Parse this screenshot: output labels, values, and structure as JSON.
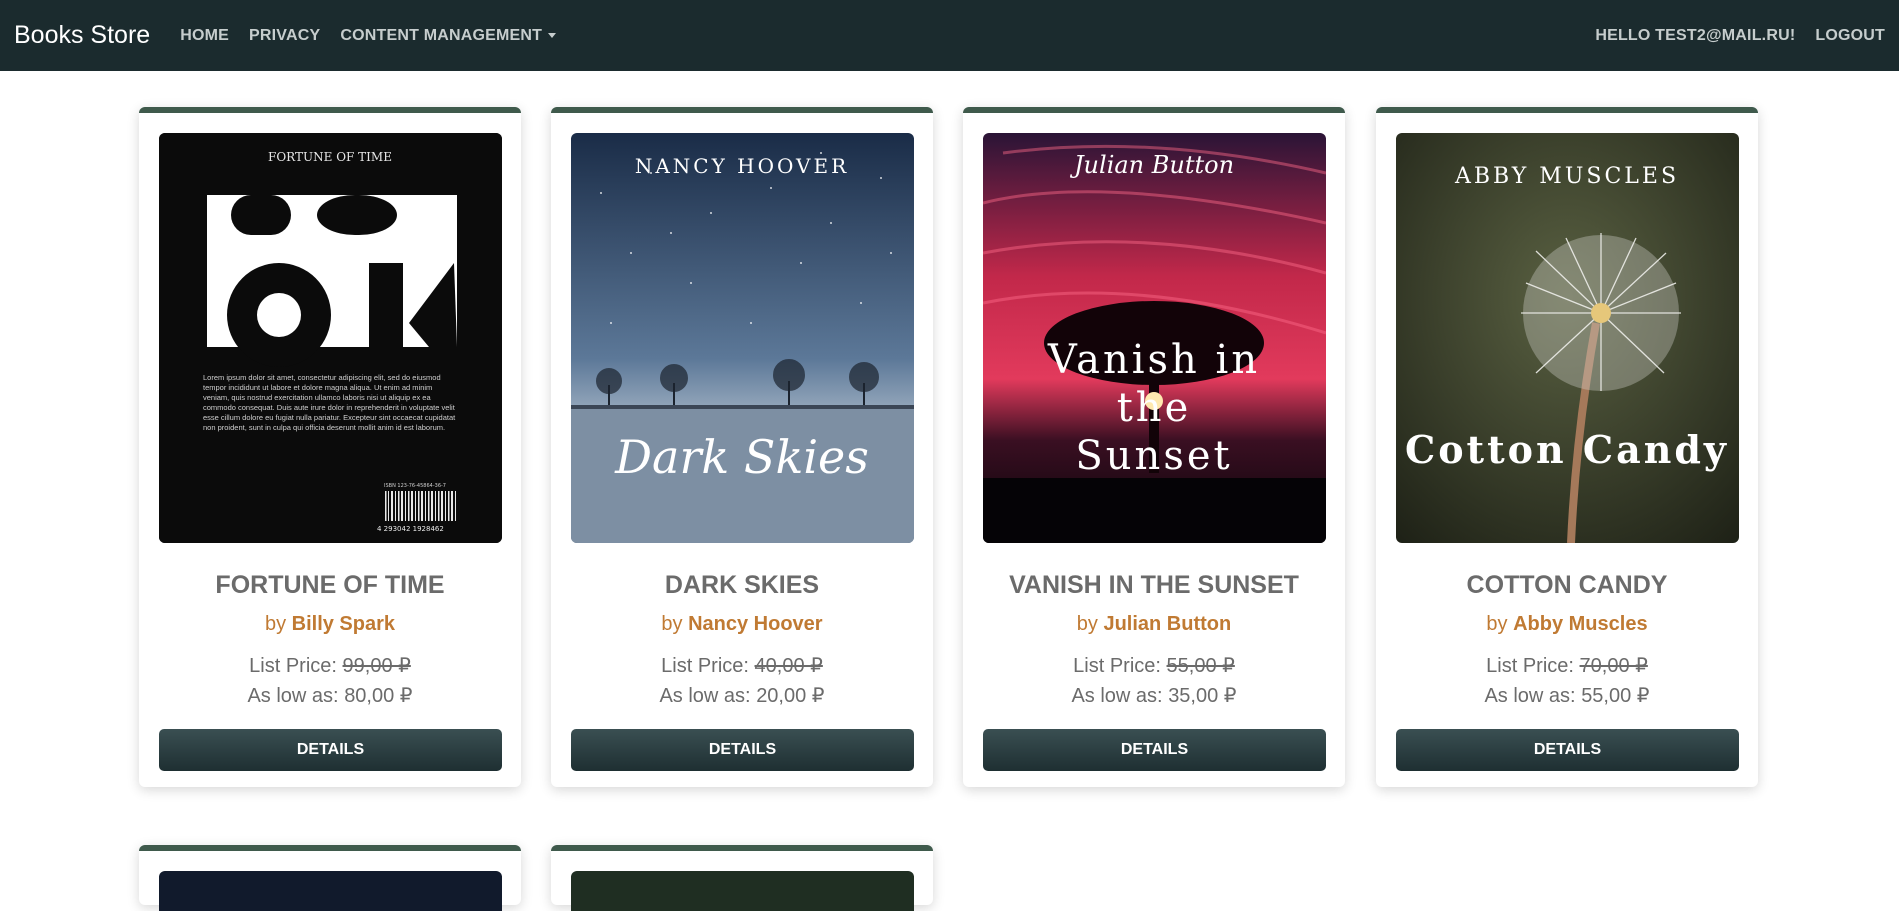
{
  "navbar": {
    "brand": "Books Store",
    "links": [
      "HOME",
      "PRIVACY",
      "CONTENT MANAGEMENT"
    ],
    "greeting": "HELLO TEST2@MAIL.RU!",
    "logout": "LOGOUT"
  },
  "labels": {
    "by": "by",
    "list_price": "List Price:",
    "as_low_as": "As low as:",
    "details": "DETAILS"
  },
  "books": [
    {
      "title": "FORTUNE OF TIME",
      "author": "Billy Spark",
      "list_price": "99,00 ₽",
      "low_price": "80,00 ₽",
      "cover_text": {
        "top": "FORTUNE OF TIME",
        "big": [
          "BO",
          "OK"
        ],
        "blurb": "Lorem ipsum dolor sit amet, consectetur adipiscing elit, sed do eiusmod tempor incididunt ut labore et dolore magna aliqua. Ut enim ad minim veniam, quis nostrud exercitation ullamco laboris nisi ut aliquip ex ea commodo consequat. Duis aute irure dolor in reprehenderit in voluptate velit esse cillum dolore eu fugiat nulla pariatur. Excepteur sint occaecat cupidatat non proident, sunt in culpa qui officia deserunt mollit anim id est laborum.",
        "isbn": "ISBN 123-76-45864-36-7",
        "barcode": "4 293042 1928462"
      }
    },
    {
      "title": "DARK SKIES",
      "author": "Nancy Hoover",
      "list_price": "40,00 ₽",
      "low_price": "20,00 ₽",
      "cover_text": {
        "top": "NANCY HOOVER",
        "main": "Dark Skies"
      }
    },
    {
      "title": "VANISH IN THE SUNSET",
      "author": "Julian Button",
      "list_price": "55,00 ₽",
      "low_price": "35,00 ₽",
      "cover_text": {
        "top": "Julian Button",
        "main": [
          "Vanish in",
          "the",
          "Sunset"
        ]
      }
    },
    {
      "title": "COTTON CANDY",
      "author": "Abby Muscles",
      "list_price": "70,00 ₽",
      "low_price": "55,00 ₽",
      "cover_text": {
        "top": "ABBY MUSCLES",
        "main": "Cotton Candy"
      }
    }
  ],
  "colors": {
    "navbar_bg": "#1b2b2e",
    "card_accent": "#3f5a4c",
    "author_link": "#c07a33",
    "button": "#2c3e40"
  }
}
